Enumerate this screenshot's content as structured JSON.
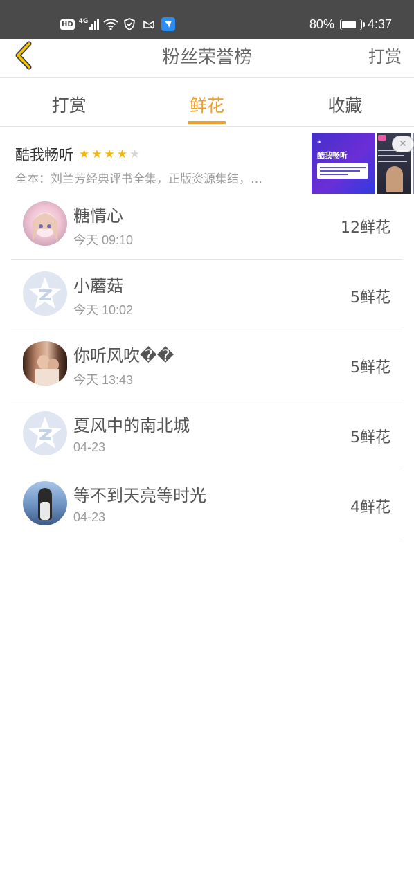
{
  "status_bar": {
    "hd": "HD",
    "network": "4G",
    "battery_percent": "80%",
    "battery_level": 0.8,
    "time": "4:37"
  },
  "header": {
    "title": "粉丝荣誉榜",
    "right_action": "打赏",
    "back_icon": "chevron-left-icon"
  },
  "tabs": [
    {
      "label": "打赏",
      "active": false
    },
    {
      "label": "鲜花",
      "active": true
    },
    {
      "label": "收藏",
      "active": false
    }
  ],
  "ad": {
    "title": "酷我畅听",
    "rating": 4,
    "rating_max": 5,
    "description": "全本：刘兰芳经典评书全集，正版资源集结，…",
    "image_title": "酷我畅听"
  },
  "fans": [
    {
      "name": "糖情心",
      "time": "今天 09:10",
      "count": "12鲜花",
      "avatar": "anime"
    },
    {
      "name": "小蘑菇",
      "time": "今天 10:02",
      "count": "5鲜花",
      "avatar": "default"
    },
    {
      "name": "你听风吹��",
      "time": "今天 13:43",
      "count": "5鲜花",
      "avatar": "photo1"
    },
    {
      "name": "夏风中的南北城",
      "time": "04-23",
      "count": "5鲜花",
      "avatar": "default"
    },
    {
      "name": "等不到天亮等时光",
      "time": "04-23",
      "count": "4鲜花",
      "avatar": "photo2"
    }
  ],
  "colors": {
    "accent": "#f0a02a",
    "status_bar": "#4a4a4a",
    "back_icon": "#f2c200",
    "star": "#f5b50a"
  }
}
